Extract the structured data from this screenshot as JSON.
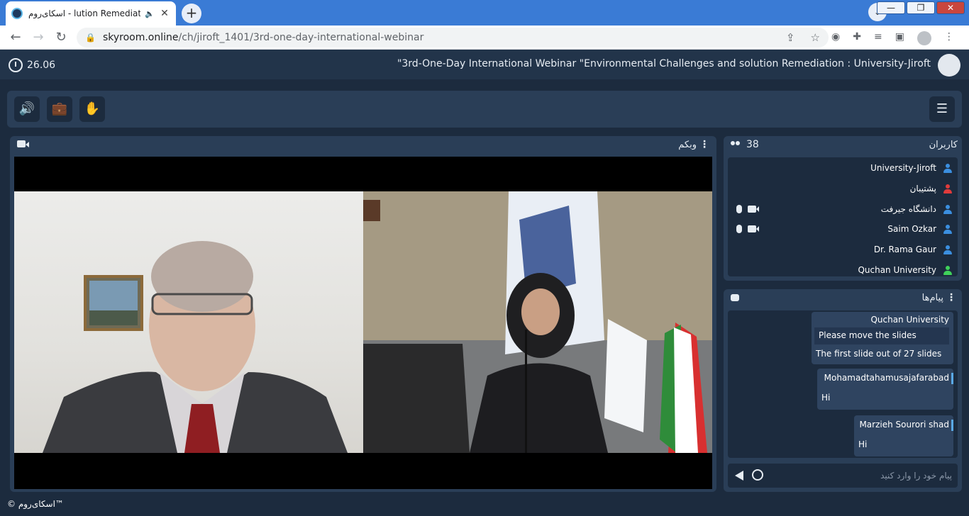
{
  "browser": {
    "tab_title": "اسکای‌روم - lution Remediation",
    "tab_audio": "🔈",
    "tab_close": "✕",
    "new_tab": "+",
    "tab_dropdown": "⌄",
    "window": {
      "minimize": "—",
      "maximize": "❐",
      "close": "✕"
    },
    "url_host": "skyroom.online",
    "url_path": "/ch/jiroft_1401/3rd-one-day-international-webinar"
  },
  "header": {
    "clock": "26.06",
    "title": "\"3rd-One-Day International Webinar \"Environmental Challenges and solution Remediation : University-Jiroft"
  },
  "controls": {
    "speaker": "🔊",
    "briefcase": "💼",
    "hand": "✋",
    "menu": "☰"
  },
  "webcam": {
    "title": "وبکم",
    "menu": "⋮"
  },
  "users": {
    "title": "کاربران",
    "count": "38",
    "list": [
      {
        "name": "University-Jiroft",
        "color": "#3b8fe0",
        "mic": false,
        "cam": false
      },
      {
        "name": "پشتیبان",
        "color": "#e03b3b",
        "mic": false,
        "cam": false
      },
      {
        "name": "دانشگاه جیرفت",
        "color": "#3b8fe0",
        "mic": true,
        "cam": true
      },
      {
        "name": "Saim Ozkar",
        "color": "#3b8fe0",
        "mic": true,
        "cam": true
      },
      {
        "name": "Dr. Rama Gaur",
        "color": "#3b8fe0",
        "mic": false,
        "cam": false
      },
      {
        "name": "Quchan University",
        "color": "#3fd15a",
        "mic": false,
        "cam": false
      }
    ]
  },
  "chat": {
    "title": "پیام‌ها",
    "menu": "⋮",
    "messages": [
      {
        "sender": "Quchan University",
        "quote": "Please move the slides",
        "text": "The first slide out of 27 slides"
      },
      {
        "sender": "Mohamadtahamusajafarabad",
        "text": "Hi"
      },
      {
        "sender": "Marzieh Sourori shad",
        "text": "Hi"
      }
    ],
    "input_placeholder": "پیام خود را وارد کنید"
  },
  "footer": {
    "brand": "© اسکای‌روم™"
  }
}
